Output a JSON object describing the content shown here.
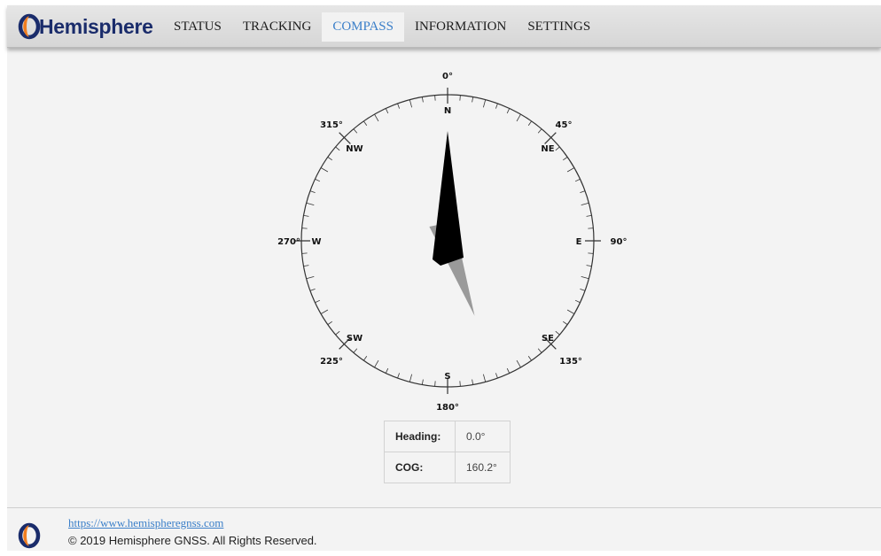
{
  "header": {
    "logo_text": "Hemisphere",
    "nav": [
      {
        "label": "STATUS"
      },
      {
        "label": "TRACKING"
      },
      {
        "label": "COMPASS",
        "active": true
      },
      {
        "label": "INFORMATION"
      },
      {
        "label": "SETTINGS"
      }
    ]
  },
  "compass": {
    "degree_labels": [
      "0°",
      "45°",
      "90°",
      "135°",
      "180°",
      "225°",
      "270°",
      "315°"
    ],
    "cardinals": [
      "N",
      "NE",
      "E",
      "SE",
      "S",
      "SW",
      "W",
      "NW"
    ],
    "heading_deg": 0.0,
    "cog_deg": 160.2
  },
  "readout": {
    "heading_label": "Heading:",
    "heading_value": "0.0°",
    "cog_label": "COG:",
    "cog_value": "160.2°"
  },
  "footer": {
    "link": "https://www.hemispheregnss.com",
    "copyright": "© 2019 Hemisphere GNSS. All Rights Reserved."
  },
  "colors": {
    "brand_navy": "#1a2c6b",
    "brand_orange": "#f07d1f",
    "active_nav": "#3b7fc9"
  }
}
